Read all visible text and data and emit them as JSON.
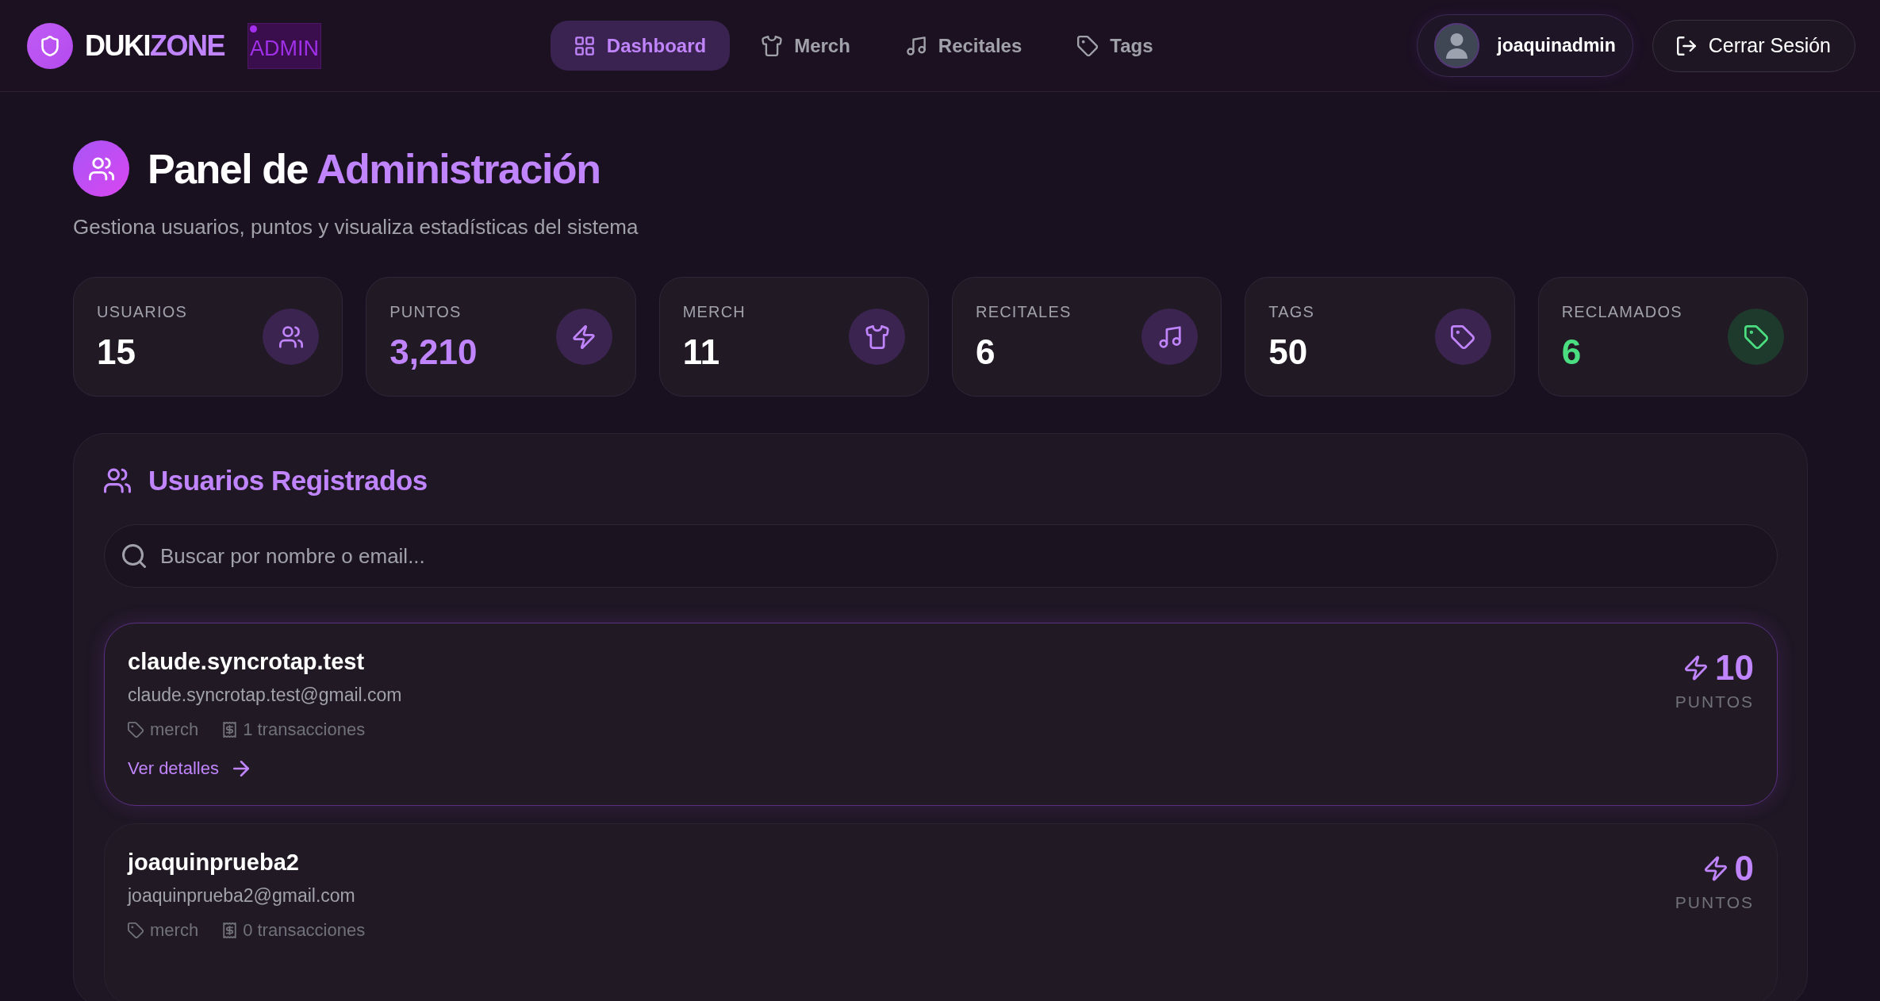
{
  "header": {
    "brand": {
      "text": "DUKI",
      "highlight": "ZONE"
    },
    "role_badge": "ADMIN",
    "nav": [
      {
        "label": "Dashboard",
        "kind": "dashboard",
        "selected": true
      },
      {
        "label": "Merch",
        "kind": "merch",
        "selected": false
      },
      {
        "label": "Recitales",
        "kind": "recitals",
        "selected": false
      },
      {
        "label": "Tags",
        "kind": "tags",
        "selected": false
      }
    ],
    "user": {
      "name": "joaquinadmin"
    },
    "logout": "Cerrar Sesión"
  },
  "page": {
    "title": {
      "text": "Panel de",
      "highlight": "Administración"
    },
    "subtitle": "Gestiona usuarios, puntos y visualiza estadísticas del sistema"
  },
  "stats": [
    {
      "label": "USUARIOS",
      "value": "15",
      "kind": "users",
      "color": "#ffffff"
    },
    {
      "label": "PUNTOS",
      "value": "3,210",
      "kind": "points",
      "color": "#c084fc"
    },
    {
      "label": "MERCH",
      "value": "11",
      "kind": "merch",
      "color": "#ffffff"
    },
    {
      "label": "RECITALES",
      "value": "6",
      "kind": "recitals",
      "color": "#ffffff"
    },
    {
      "label": "TAGS",
      "value": "50",
      "kind": "tags",
      "color": "#ffffff"
    },
    {
      "label": "RECLAMADOS",
      "value": "6",
      "kind": "claimed",
      "color": "#4ade80"
    }
  ],
  "users_panel": {
    "title": "Usuarios Registrados",
    "search": {
      "placeholder": "Buscar por nombre o email..."
    },
    "users": [
      {
        "name": "claude.syncrotap.test",
        "email": "claude.syncrotap.test@gmail.com",
        "tag": "merch",
        "transactions": "1 transacciones",
        "points": "10",
        "points_label": "PUNTOS",
        "link": "Ver detalles",
        "highlighted": true
      },
      {
        "name": "joaquinprueba2",
        "email": "joaquinprueba2@gmail.com",
        "tag": "merch",
        "transactions": "0 transacciones",
        "points": "0",
        "points_label": "PUNTOS",
        "highlighted": false
      }
    ]
  }
}
